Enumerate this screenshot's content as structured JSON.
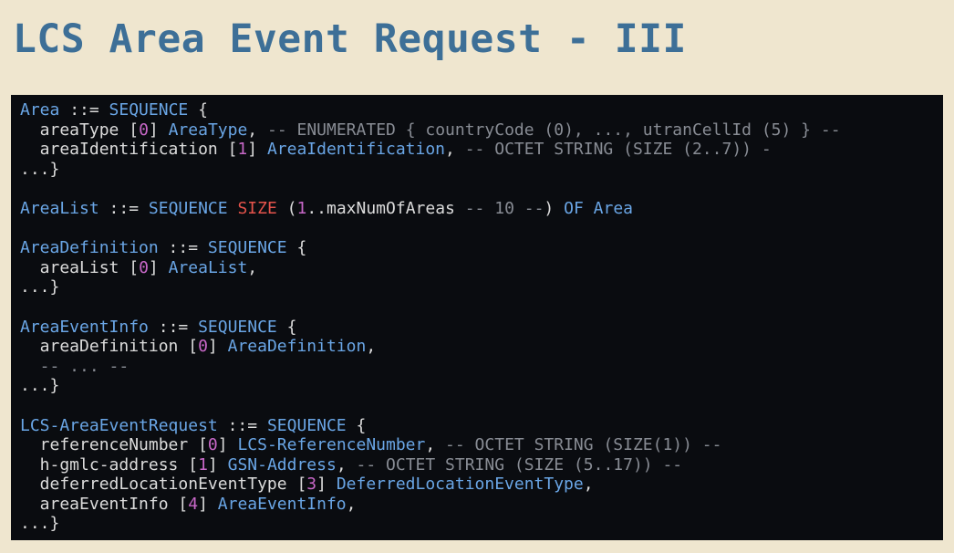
{
  "title": "LCS Area Event Request - III",
  "code": [
    [
      [
        "type",
        "Area"
      ],
      [
        "punct",
        " ::= "
      ],
      [
        "kw",
        "SEQUENCE"
      ],
      [
        "punct",
        " {"
      ]
    ],
    [
      [
        "field",
        "  areaType "
      ],
      [
        "punct",
        "["
      ],
      [
        "num",
        "0"
      ],
      [
        "punct",
        "] "
      ],
      [
        "type",
        "AreaType"
      ],
      [
        "punct",
        ", "
      ],
      [
        "comment",
        "-- ENUMERATED { countryCode (0), ..., utranCellId (5) } --"
      ]
    ],
    [
      [
        "field",
        "  areaIdentification "
      ],
      [
        "punct",
        "["
      ],
      [
        "num",
        "1"
      ],
      [
        "punct",
        "] "
      ],
      [
        "type",
        "AreaIdentification"
      ],
      [
        "punct",
        ", "
      ],
      [
        "comment",
        "-- OCTET STRING (SIZE (2..7)) -"
      ]
    ],
    [
      [
        "punct",
        "...}"
      ]
    ],
    [],
    [
      [
        "type",
        "AreaList"
      ],
      [
        "punct",
        " ::= "
      ],
      [
        "kw",
        "SEQUENCE"
      ],
      [
        "punct",
        " "
      ],
      [
        "red",
        "SIZE"
      ],
      [
        "punct",
        " ("
      ],
      [
        "num",
        "1"
      ],
      [
        "punct",
        "..maxNumOfAreas "
      ],
      [
        "comment",
        "-- 10 --"
      ],
      [
        "punct",
        ") "
      ],
      [
        "kw",
        "OF"
      ],
      [
        "punct",
        " "
      ],
      [
        "type",
        "Area"
      ]
    ],
    [],
    [
      [
        "type",
        "AreaDefinition"
      ],
      [
        "punct",
        " ::= "
      ],
      [
        "kw",
        "SEQUENCE"
      ],
      [
        "punct",
        " {"
      ]
    ],
    [
      [
        "field",
        "  areaList "
      ],
      [
        "punct",
        "["
      ],
      [
        "num",
        "0"
      ],
      [
        "punct",
        "] "
      ],
      [
        "type",
        "AreaList"
      ],
      [
        "punct",
        ","
      ]
    ],
    [
      [
        "punct",
        "...}"
      ]
    ],
    [],
    [
      [
        "type",
        "AreaEventInfo"
      ],
      [
        "punct",
        " ::= "
      ],
      [
        "kw",
        "SEQUENCE"
      ],
      [
        "punct",
        " {"
      ]
    ],
    [
      [
        "field",
        "  areaDefinition "
      ],
      [
        "punct",
        "["
      ],
      [
        "num",
        "0"
      ],
      [
        "punct",
        "] "
      ],
      [
        "type",
        "AreaDefinition"
      ],
      [
        "punct",
        ","
      ]
    ],
    [
      [
        "comment",
        "  -- ... --"
      ]
    ],
    [
      [
        "punct",
        "...}"
      ]
    ],
    [],
    [
      [
        "type",
        "LCS-AreaEventRequest"
      ],
      [
        "punct",
        " ::= "
      ],
      [
        "kw",
        "SEQUENCE"
      ],
      [
        "punct",
        " {"
      ]
    ],
    [
      [
        "field",
        "  referenceNumber "
      ],
      [
        "punct",
        "["
      ],
      [
        "num",
        "0"
      ],
      [
        "punct",
        "] "
      ],
      [
        "type",
        "LCS-ReferenceNumber"
      ],
      [
        "punct",
        ", "
      ],
      [
        "comment",
        "-- OCTET STRING (SIZE(1)) --"
      ]
    ],
    [
      [
        "field",
        "  h-gmlc-address "
      ],
      [
        "punct",
        "["
      ],
      [
        "num",
        "1"
      ],
      [
        "punct",
        "] "
      ],
      [
        "type",
        "GSN-Address"
      ],
      [
        "punct",
        ", "
      ],
      [
        "comment",
        "-- OCTET STRING (SIZE (5..17)) --"
      ]
    ],
    [
      [
        "field",
        "  deferredLocationEventType "
      ],
      [
        "punct",
        "["
      ],
      [
        "num",
        "3"
      ],
      [
        "punct",
        "] "
      ],
      [
        "type",
        "DeferredLocationEventType"
      ],
      [
        "punct",
        ","
      ]
    ],
    [
      [
        "field",
        "  areaEventInfo "
      ],
      [
        "punct",
        "["
      ],
      [
        "num",
        "4"
      ],
      [
        "punct",
        "] "
      ],
      [
        "type",
        "AreaEventInfo"
      ],
      [
        "punct",
        ","
      ]
    ],
    [
      [
        "punct",
        "...}"
      ]
    ]
  ],
  "colors": {
    "background": "#efe6cf",
    "title": "#3d6f97",
    "panel": "#0a0c10",
    "type": "#6aa6e6",
    "number": "#c868c8",
    "size_keyword": "#e5534b",
    "comment": "#888c94",
    "text": "#dcdcdc"
  }
}
